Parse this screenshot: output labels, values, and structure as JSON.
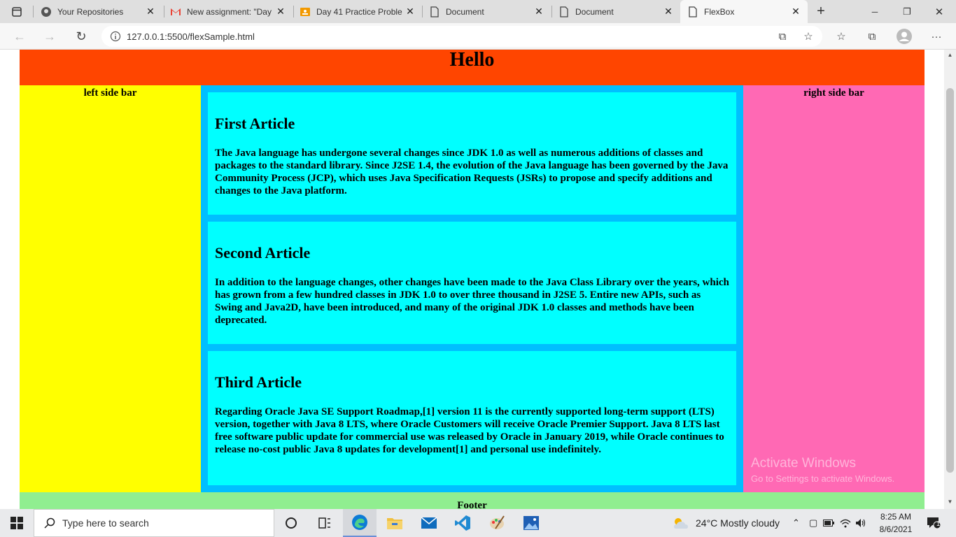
{
  "browser": {
    "tabs": [
      {
        "label": "Your Repositories",
        "icon": "github-icon",
        "active": false
      },
      {
        "label": "New assignment: \"Day",
        "icon": "gmail-icon",
        "active": false
      },
      {
        "label": "Day 41 Practice Proble",
        "icon": "classroom-icon",
        "active": false
      },
      {
        "label": "Document",
        "icon": "document-icon",
        "active": false
      },
      {
        "label": "Document",
        "icon": "document-icon",
        "active": false
      },
      {
        "label": "FlexBox",
        "icon": "document-icon",
        "active": true
      }
    ],
    "url": "127.0.0.1:5500/flexSample.html",
    "window_controls": {
      "minimize": "─",
      "restore": "❐",
      "close": "✕"
    }
  },
  "page": {
    "header": "Hello",
    "left_sidebar": "left side bar",
    "right_sidebar": "right side bar",
    "articles": [
      {
        "title": "First Article",
        "body": "The Java language has undergone several changes since JDK 1.0 as well as numerous additions of classes and packages to the standard library. Since J2SE 1.4, the evolution of the Java language has been governed by the Java Community Process (JCP), which uses Java Specification Requests (JSRs) to propose and specify additions and changes to the Java platform."
      },
      {
        "title": "Second Article",
        "body": "In addition to the language changes, other changes have been made to the Java Class Library over the years, which has grown from a few hundred classes in JDK 1.0 to over three thousand in J2SE 5. Entire new APIs, such as Swing and Java2D, have been introduced, and many of the original JDK 1.0 classes and methods have been deprecated."
      },
      {
        "title": "Third Article",
        "body": "Regarding Oracle Java SE Support Roadmap,[1] version 11 is the currently supported long-term support (LTS) version, together with Java 8 LTS, where Oracle Customers will receive Oracle Premier Support. Java 8 LTS last free software public update for commercial use was released by Oracle in January 2019, while Oracle continues to release no-cost public Java 8 updates for development[1] and personal use indefinitely."
      }
    ],
    "footer": "Footer",
    "watermark": {
      "line1": "Activate Windows",
      "line2": "Go to Settings to activate Windows."
    }
  },
  "taskbar": {
    "search_placeholder": "Type here to search",
    "weather": "24°C  Mostly cloudy",
    "time": "8:25 AM",
    "date": "8/6/2021",
    "notification_count": "1"
  },
  "colors": {
    "header": "#ff4500",
    "left_sidebar": "#ffff00",
    "main": "#00bfff",
    "article": "#00ffff",
    "right_sidebar": "#ff69b4",
    "footer": "#90ee90"
  }
}
